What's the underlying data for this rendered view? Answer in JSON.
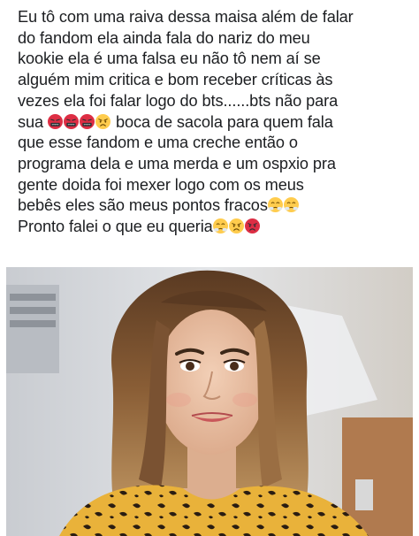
{
  "post": {
    "lines": [
      {
        "text": "Eu tô com uma raiva dessa maisa além de falar"
      },
      {
        "text": "do fandom ela ainda fala do nariz do meu"
      },
      {
        "text": "kookie ela é uma falsa eu não tô nem aí se"
      },
      {
        "text": "alguém mim critica e bom receber críticas às"
      },
      {
        "text": "vezes ela foi falar logo do bts......bts não para"
      },
      {
        "text": "sua",
        "after": "boca de sacola para quem fala"
      },
      {
        "text": "que esse fandom e uma creche então o"
      },
      {
        "text": "programa dela e uma merda e um ospxio pra"
      },
      {
        "text": "gente doida foi mexer logo com os meus"
      },
      {
        "text": "bebês eles são meus pontos fracos"
      },
      {
        "text": "Pronto falei o que eu queria"
      }
    ],
    "emojis": {
      "line6": [
        "cursing-face-emoji",
        "cursing-face-emoji",
        "cursing-face-emoji",
        "pouting-face-emoji"
      ],
      "line10": [
        "steam-nose-face-emoji",
        "steam-nose-face-emoji"
      ],
      "line11": [
        "steam-nose-face-emoji",
        "pouting-face-emoji",
        "red-angry-face-emoji"
      ]
    },
    "colors": {
      "text": "#1c1e21",
      "emoji_orange": "#f4900c",
      "emoji_red": "#dd2e44",
      "emoji_yellow": "#ffcc4d"
    }
  },
  "photo": {
    "subject": "selfie-photo"
  }
}
